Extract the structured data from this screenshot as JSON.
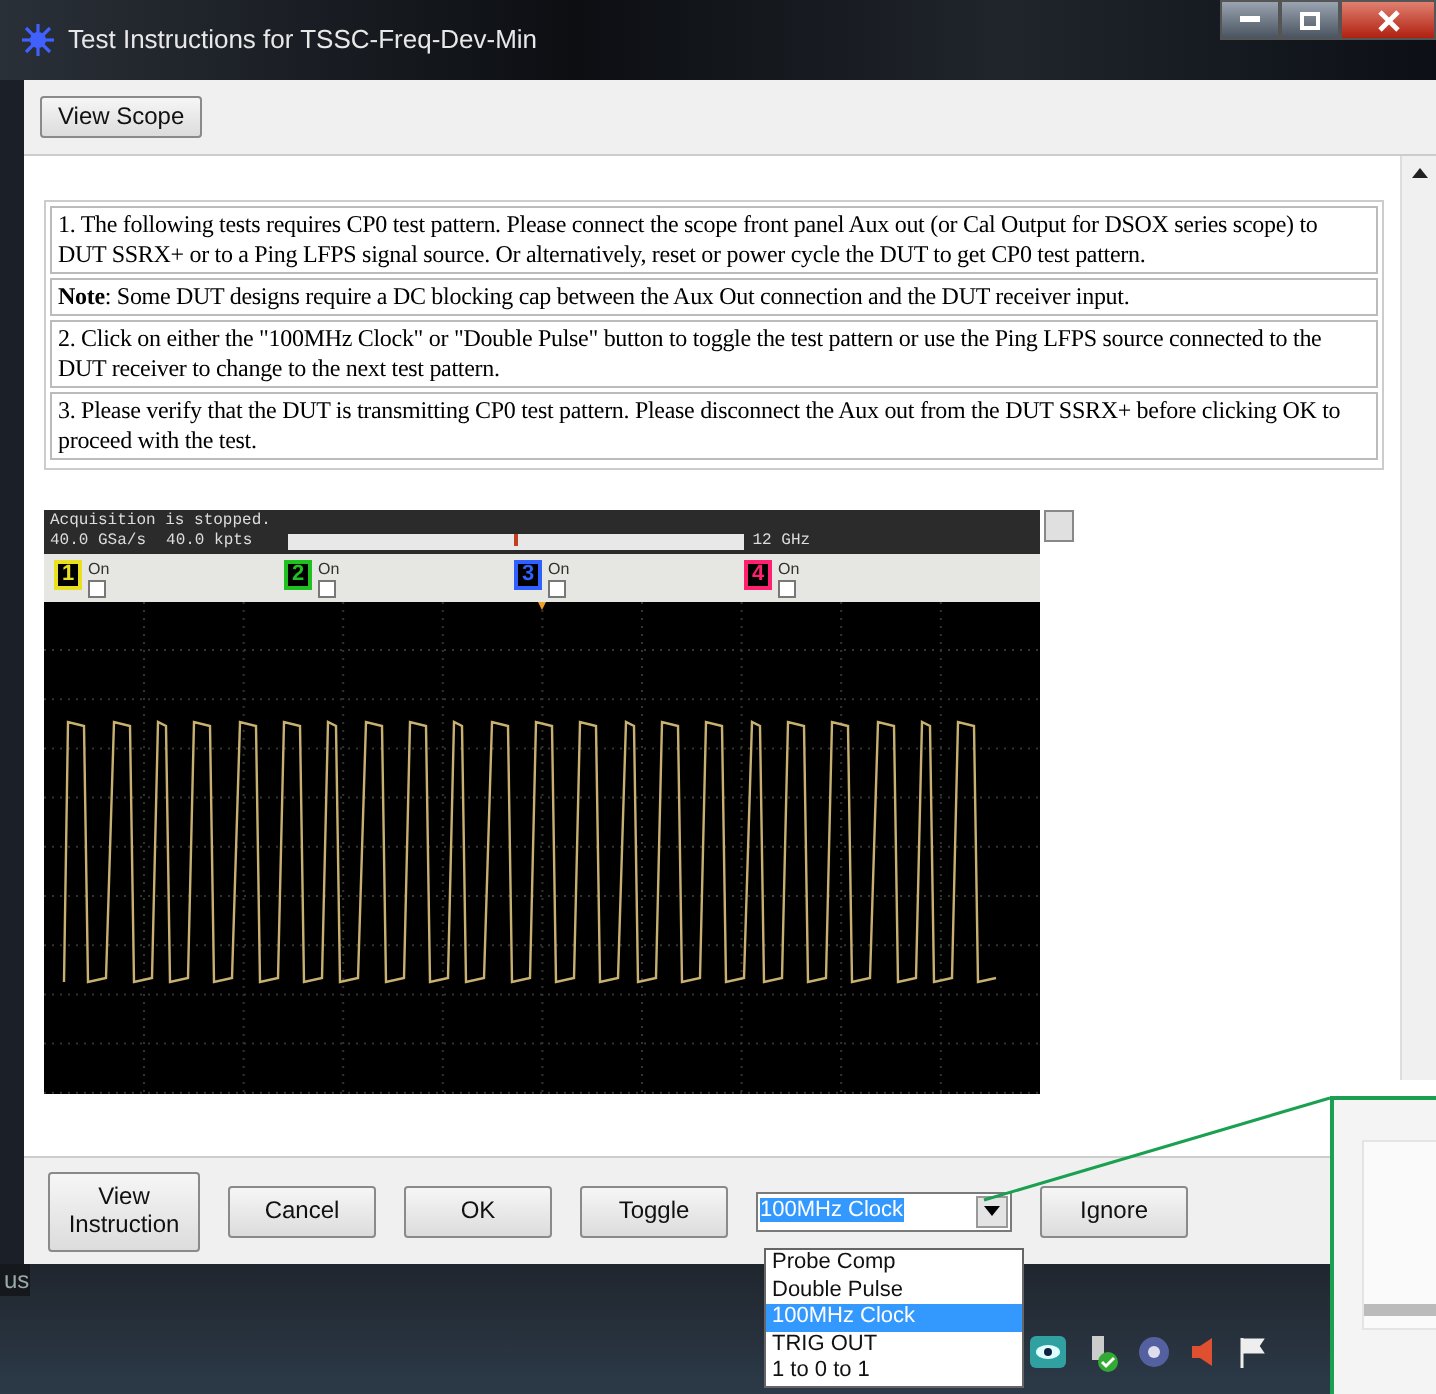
{
  "window": {
    "title": "Test Instructions for TSSC-Freq-Dev-Min"
  },
  "toolbar": {
    "button": "View Scope"
  },
  "instructions": [
    {
      "text": "1. The following tests requires CP0 test pattern. Please connect the scope front panel Aux out (or Cal Output for DSOX series scope) to DUT SSRX+ or to a Ping LFPS signal source. Or alternatively, reset or power cycle the DUT to get CP0 test pattern."
    },
    {
      "text": "**Note**: Some DUT designs require a DC blocking cap between the Aux Out connection and the DUT receiver input."
    },
    {
      "text": "2. Click on either the \"100MHz Clock\" or \"Double Pulse\" button to toggle the test pattern or use the Ping LFPS source connected to the DUT receiver to change to the next test pattern."
    },
    {
      "text": "3. Please verify that the DUT is transmitting CP0 test pattern. Please disconnect the Aux out from the DUT SSRX+ before clicking OK to proceed with the test."
    }
  ],
  "scope": {
    "status": "Acquisition is stopped.",
    "sample_rate": "40.0 GSa/s",
    "points": "40.0 kpts",
    "bandwidth": "12 GHz",
    "channels": [
      {
        "number": "1",
        "label": "On",
        "checked": false,
        "color": "#e8e020"
      },
      {
        "number": "2",
        "label": "On",
        "checked": false,
        "color": "#20c020"
      },
      {
        "number": "3",
        "label": "On",
        "checked": false,
        "color": "#3060ff"
      },
      {
        "number": "4",
        "label": "On",
        "checked": false,
        "color": "#ff2070"
      }
    ]
  },
  "controls": [
    {
      "kind": "button",
      "label": "View Instruction"
    },
    {
      "kind": "button",
      "label": "Cancel"
    },
    {
      "kind": "button",
      "label": "OK"
    },
    {
      "kind": "button",
      "label": "Toggle"
    },
    {
      "kind": "dropdown",
      "value": "100MHz Clock",
      "expanded": true,
      "options": [
        {
          "label": "Probe Comp",
          "selected": false
        },
        {
          "label": "Double Pulse",
          "selected": false
        },
        {
          "label": "100MHz Clock",
          "selected": true
        },
        {
          "label": "TRIG OUT",
          "selected": false
        },
        {
          "label": "1 to 0 to 1",
          "selected": false
        }
      ]
    },
    {
      "kind": "button",
      "label": "Ignore"
    }
  ],
  "taskbar": {
    "text": "us"
  }
}
